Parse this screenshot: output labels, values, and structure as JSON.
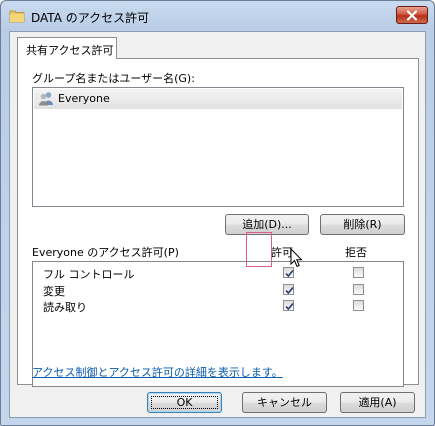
{
  "window": {
    "title": "DATA のアクセス許可",
    "icons": {
      "folder": "folder-icon",
      "close": "close-icon"
    }
  },
  "tabs": [
    {
      "label": "共有アクセス許可",
      "selected": true
    }
  ],
  "group_section": {
    "label": "グループ名またはユーザー名(G):",
    "users": [
      {
        "name": "Everyone",
        "icon": "user-group-icon",
        "selected": true
      }
    ],
    "add_button": "追加(D)...",
    "remove_button": "削除(R)"
  },
  "permissions": {
    "label": "Everyone のアクセス許可(P)",
    "allow_header": "許可",
    "deny_header": "拒否",
    "rows": [
      {
        "name": "フル コントロール",
        "allow": true,
        "deny": false
      },
      {
        "name": "変更",
        "allow": true,
        "deny": false
      },
      {
        "name": "読み取り",
        "allow": true,
        "deny": false
      }
    ]
  },
  "help_link": "アクセス制御とアクセス許可の詳細を表示します。",
  "footer": {
    "ok": "OK",
    "cancel": "キャンセル",
    "apply": "適用(A)"
  },
  "colors": {
    "title_bar": "#c4d6ec",
    "close_button": "#c84a33",
    "link": "#0b5cad",
    "highlight": "#e05a8a"
  }
}
